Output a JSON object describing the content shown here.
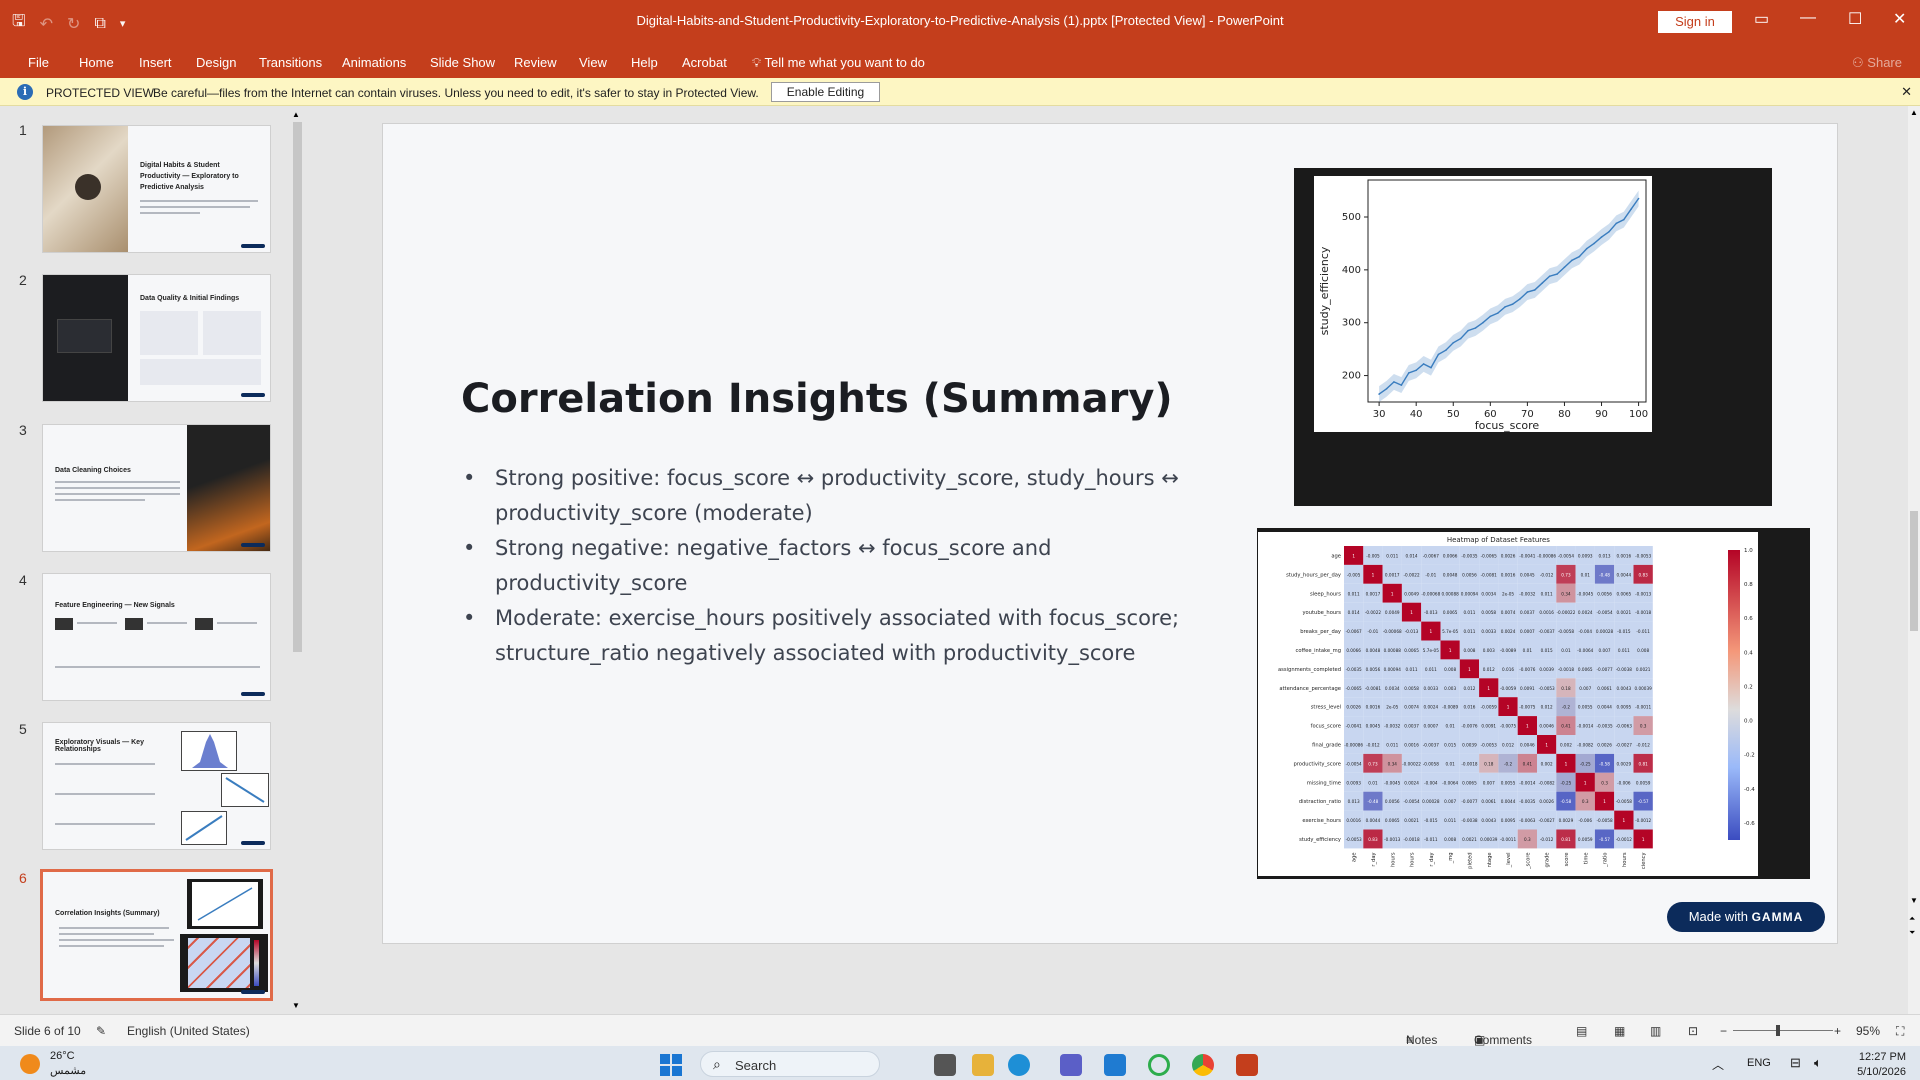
{
  "window": {
    "title": "Digital-Habits-and-Student-Productivity-Exploratory-to-Predictive-Analysis (1).pptx [Protected View]  -  PowerPoint",
    "sign_in": "Sign in",
    "min": "—",
    "max": "☐",
    "close": "✕"
  },
  "ribbon": {
    "tabs": [
      "File",
      "Home",
      "Insert",
      "Design",
      "Transitions",
      "Animations",
      "Slide Show",
      "Review",
      "View",
      "Help",
      "Acrobat"
    ],
    "tell_me": "Tell me what you want to do",
    "share": "Share"
  },
  "protected_view": {
    "label": "PROTECTED VIEW",
    "message": "Be careful—files from the Internet can contain viruses. Unless you need to edit, it's safer to stay in Protected View.",
    "button": "Enable Editing"
  },
  "thumbnails": [
    {
      "num": "1",
      "title": "Digital Habits & Student Productivity — Exploratory to Predictive Analysis"
    },
    {
      "num": "2",
      "title": "Data Quality & Initial Findings"
    },
    {
      "num": "3",
      "title": "Data Cleaning Choices"
    },
    {
      "num": "4",
      "title": "Feature Engineering — New Signals"
    },
    {
      "num": "5",
      "title": "Exploratory Visuals — Key Relationships"
    },
    {
      "num": "6",
      "title": "Correlation Insights (Summary)"
    }
  ],
  "slide": {
    "title": "Correlation Insights (Summary)",
    "bullets": [
      "Strong positive: focus_score ↔ productivity_score, study_hours ↔ productivity_score (moderate)",
      "Strong negative: negative_factors ↔ focus_score and productivity_score",
      "Moderate: exercise_hours positively associated with focus_score; structure_ratio negatively associated with productivity_score"
    ],
    "badge_prefix": "Made with",
    "badge_brand": "GAMMA"
  },
  "chart_data": [
    {
      "type": "line",
      "title": "",
      "xlabel": "focus_score",
      "ylabel": "study_efficiency",
      "xlim": [
        27,
        102
      ],
      "ylim": [
        150,
        570
      ],
      "xticks": [
        30,
        40,
        50,
        60,
        70,
        80,
        90,
        100
      ],
      "yticks": [
        200,
        300,
        400,
        500
      ],
      "grid": false,
      "x": [
        30,
        32,
        34,
        36,
        38,
        40,
        42,
        44,
        46,
        48,
        50,
        52,
        54,
        56,
        58,
        60,
        62,
        64,
        66,
        68,
        70,
        72,
        74,
        76,
        78,
        80,
        82,
        84,
        86,
        88,
        90,
        92,
        94,
        96,
        98,
        100
      ],
      "y": [
        165,
        175,
        188,
        182,
        205,
        210,
        222,
        215,
        240,
        248,
        262,
        270,
        285,
        290,
        300,
        312,
        318,
        330,
        335,
        345,
        358,
        362,
        375,
        388,
        392,
        405,
        418,
        425,
        440,
        450,
        462,
        472,
        488,
        495,
        515,
        535
      ],
      "band": 15,
      "color": "#3a7dbf"
    },
    {
      "type": "heatmap",
      "title": "Heatmap of Dataset Features",
      "rows": [
        "age",
        "study_hours_per_day",
        "sleep_hours",
        "youtube_hours",
        "breaks_per_day",
        "coffee_intake_mg",
        "assignments_completed",
        "attendance_percentage",
        "stress_level",
        "focus_score",
        "final_grade",
        "productivity_score",
        "missing_time",
        "distraction_ratio",
        "exercise_hours",
        "study_efficiency"
      ],
      "col_labels": [
        "age",
        "r_day",
        "hours",
        "hours",
        "r_day",
        "_mg",
        "pleted",
        "ntage",
        "_level",
        "_score",
        "grade",
        "score",
        "time",
        "_ratio",
        "hours",
        "ciency"
      ],
      "values": [
        [
          "1",
          "-0.005",
          "0.011",
          "0.014",
          "-0.0067",
          "0.0066",
          "-0.0035",
          "-0.0065",
          "0.0026",
          "-0.0041",
          "-0.00086",
          "-0.0054",
          "0.0093",
          "0.013",
          "0.0016",
          "-0.0053"
        ],
        [
          "-0.005",
          "1",
          "0.0017",
          "-0.0022",
          "-0.01",
          "0.0048",
          "0.0056",
          "-0.0081",
          "0.0016",
          "0.0045",
          "-0.012",
          "0.73",
          "0.01",
          "-0.48",
          "0.0044",
          "0.83"
        ],
        [
          "0.011",
          "0.0017",
          "1",
          "0.0049",
          "-0.00068",
          "0.00088",
          "0.00094",
          "0.0034",
          "2e-05",
          "-0.0032",
          "0.011",
          "0.34",
          "-0.0045",
          "0.0056",
          "0.0065",
          "-0.0013"
        ],
        [
          "0.014",
          "-0.0022",
          "0.0049",
          "1",
          "-0.013",
          "0.0065",
          "0.011",
          "0.0058",
          "0.0074",
          "0.0037",
          "0.0016",
          "-0.00022",
          "0.0024",
          "-0.0054",
          "0.0021",
          "-0.0018"
        ],
        [
          "-0.0067",
          "-0.01",
          "-0.00068",
          "-0.013",
          "1",
          "5.7e-05",
          "0.011",
          "0.0033",
          "0.0024",
          "0.0007",
          "-0.0037",
          "-0.0058",
          "-0.004",
          "0.00028",
          "-0.015",
          "-0.011"
        ],
        [
          "0.0066",
          "0.0048",
          "0.00088",
          "0.0065",
          "5.7e-05",
          "1",
          "0.008",
          "0.003",
          "-0.0089",
          "0.01",
          "0.015",
          "0.01",
          "-0.0064",
          "0.007",
          "0.011",
          "0.008"
        ],
        [
          "-0.0035",
          "0.0056",
          "0.00094",
          "0.011",
          "0.011",
          "0.008",
          "1",
          "0.012",
          "0.016",
          "-0.0076",
          "0.0039",
          "-0.0018",
          "0.0065",
          "-0.0077",
          "-0.0038",
          "0.0021"
        ],
        [
          "-0.0065",
          "-0.0081",
          "0.0034",
          "0.0058",
          "0.0033",
          "0.003",
          "0.012",
          "1",
          "-0.0059",
          "0.0091",
          "-0.0053",
          "0.18",
          "0.007",
          "0.0061",
          "0.0043",
          "0.00039"
        ],
        [
          "0.0026",
          "0.0016",
          "2e-05",
          "0.0074",
          "0.0024",
          "-0.0089",
          "0.016",
          "-0.0059",
          "1",
          "-0.0075",
          "0.012",
          "-0.2",
          "0.0055",
          "0.0044",
          "0.0095",
          "-0.0011"
        ],
        [
          "-0.0041",
          "0.0045",
          "-0.0032",
          "0.0037",
          "0.0007",
          "0.01",
          "-0.0076",
          "0.0091",
          "-0.0075",
          "1",
          "0.0046",
          "0.41",
          "-0.0014",
          "-0.0035",
          "-0.0063",
          "0.3"
        ],
        [
          "-0.00086",
          "-0.012",
          "0.011",
          "0.0016",
          "-0.0037",
          "0.015",
          "0.0039",
          "-0.0053",
          "0.012",
          "0.0046",
          "1",
          "0.002",
          "-0.0082",
          "0.0026",
          "-0.0027",
          "-0.012"
        ],
        [
          "-0.0054",
          "0.73",
          "0.34",
          "-0.00022",
          "-0.0058",
          "0.01",
          "-0.0018",
          "0.18",
          "-0.2",
          "0.41",
          "0.002",
          "1",
          "-0.25",
          "-0.58",
          "0.0029",
          "0.81"
        ],
        [
          "0.0093",
          "0.01",
          "-0.0045",
          "0.0024",
          "-0.004",
          "-0.0064",
          "0.0065",
          "0.007",
          "0.0055",
          "-0.0014",
          "-0.0082",
          "-0.25",
          "1",
          "0.3",
          "-0.006",
          "0.0059"
        ],
        [
          "0.013",
          "-0.48",
          "0.0056",
          "-0.0054",
          "0.00028",
          "0.007",
          "-0.0077",
          "0.0061",
          "0.0044",
          "-0.0035",
          "0.0026",
          "-0.58",
          "0.3",
          "1",
          "-0.0058",
          "-0.57"
        ],
        [
          "0.0016",
          "0.0044",
          "0.0065",
          "0.0021",
          "-0.015",
          "0.011",
          "-0.0038",
          "0.0043",
          "0.0095",
          "-0.0063",
          "-0.0027",
          "0.0029",
          "-0.006",
          "-0.0058",
          "1",
          "-0.0012"
        ],
        [
          "-0.0053",
          "0.83",
          "-0.0013",
          "-0.0018",
          "-0.011",
          "0.008",
          "0.0021",
          "0.00039",
          "-0.0011",
          "0.3",
          "-0.012",
          "0.81",
          "0.0059",
          "-0.57",
          "-0.0012",
          "1"
        ]
      ],
      "colorbar_ticks": [
        "1.0",
        "0.8",
        "0.6",
        "0.4",
        "0.2",
        "0.0",
        "-0.2",
        "-0.4",
        "-0.6"
      ],
      "colormap": "coolwarm"
    }
  ],
  "statusbar": {
    "slide_info": "Slide 6 of 10",
    "language": "English (United States)",
    "notes": "Notes",
    "comments": "Comments",
    "zoom": "95%"
  },
  "taskbar": {
    "temp": "26°C",
    "condition": "مشمس",
    "search": "Search",
    "lang": "ENG",
    "time": "12:27 PM",
    "date": "5/10/2026"
  }
}
